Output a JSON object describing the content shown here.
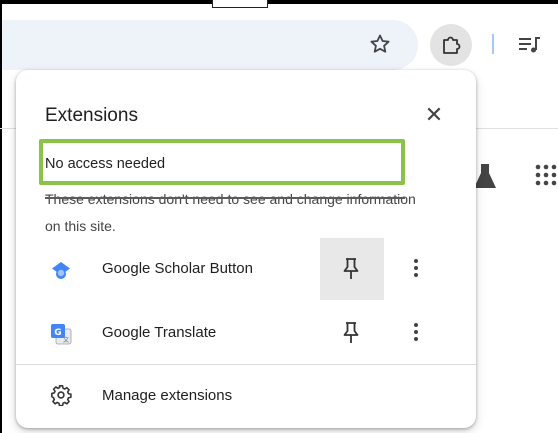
{
  "popup": {
    "title": "Extensions",
    "close_icon": "close-icon",
    "section": {
      "heading": "No access needed",
      "description": "These extensions don't need to see and change information on this site."
    },
    "extensions": [
      {
        "name": "Google Scholar Button",
        "icon": "google-scholar-icon",
        "pin_icon": "pin-icon",
        "menu_icon": "more-vert-icon",
        "hovered": true
      },
      {
        "name": "Google Translate",
        "icon": "google-translate-icon",
        "pin_icon": "pin-icon",
        "menu_icon": "more-vert-icon",
        "hovered": false
      }
    ],
    "manage_label": "Manage extensions",
    "manage_icon": "gear-icon"
  },
  "toolbar": {
    "bookmark_icon": "star-icon",
    "extensions_icon": "puzzle-icon",
    "media_icon": "media-control-icon"
  },
  "colors": {
    "highlight": "#8bc34a",
    "omnibox": "#eef2f9",
    "scholar_blue": "#4285f4"
  }
}
